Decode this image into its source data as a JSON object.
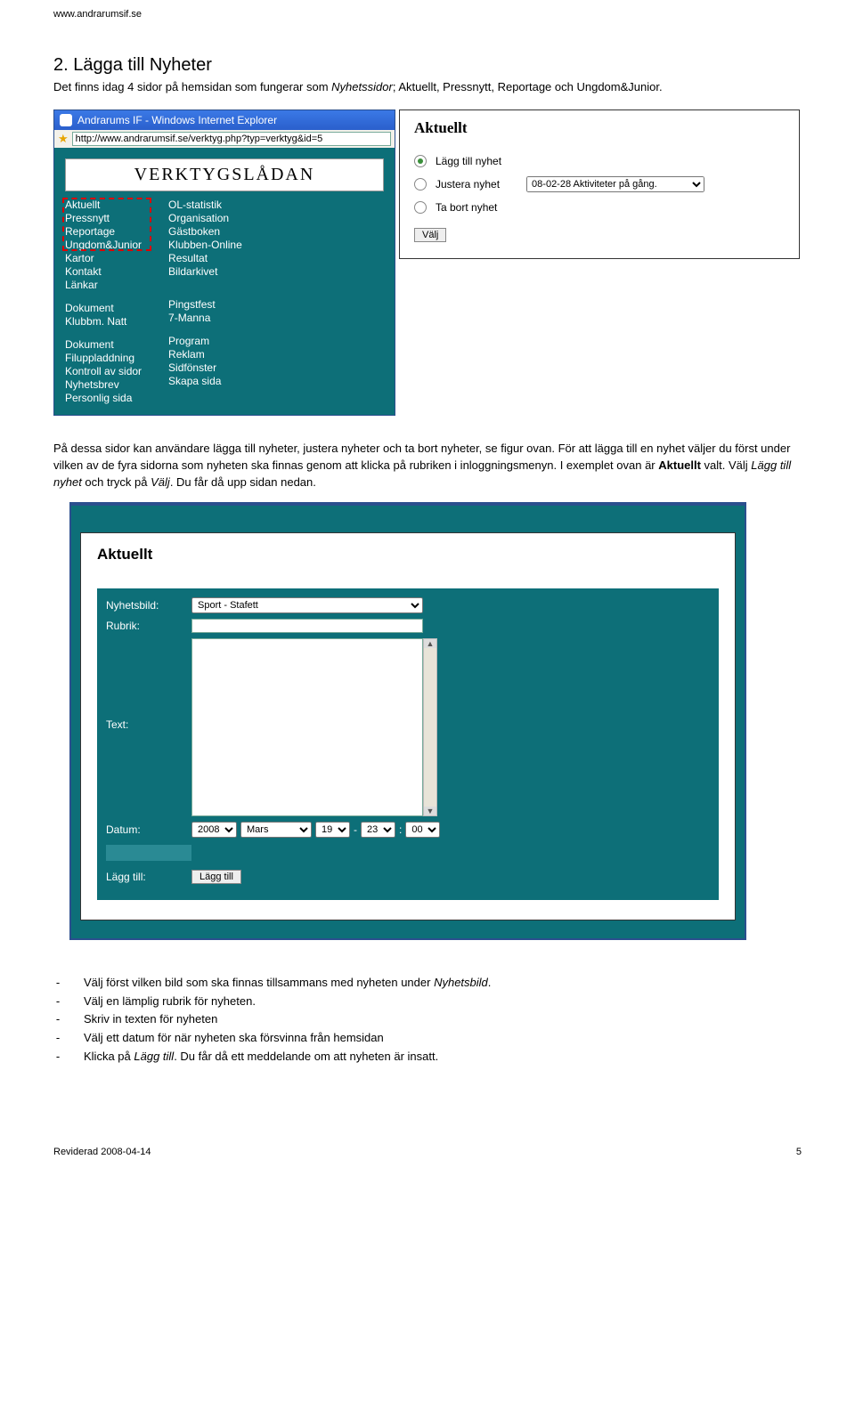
{
  "site_url": "www.andrarumsif.se",
  "heading": "2. Lägga till Nyheter",
  "intro": {
    "part1": "Det finns idag 4 sidor på hemsidan som fungerar som ",
    "italic1": "Nyhetssidor",
    "part2": "; Aktuellt, Pressnytt, Reportage och Ungdom&Junior."
  },
  "ie": {
    "title": "Andrarums IF - Windows Internet Explorer",
    "url": "http://www.andrarumsif.se/verktyg.php?typ=verktyg&id=5"
  },
  "toolsbox_title": "VERKTYGSLÅDAN",
  "tools_col1": [
    "Aktuellt",
    "Pressnytt",
    "Reportage",
    "Ungdom&Junior",
    "Kartor",
    "Kontakt",
    "Länkar",
    "",
    "Dokument",
    "Klubbm. Natt",
    "",
    "Dokument",
    "Filuppladdning",
    "Kontroll av sidor",
    "Nyhetsbrev",
    "Personlig sida"
  ],
  "tools_col2": [
    "OL-statistik",
    "Organisation",
    "Gästboken",
    "Klubben-Online",
    "Resultat",
    "Bildarkivet",
    "",
    "",
    "Pingstfest",
    "7-Manna",
    "",
    "Program",
    "Reklam",
    "Sidfönster",
    "Skapa sida",
    ""
  ],
  "panel": {
    "title": "Aktuellt",
    "opt1": "Lägg till nyhet",
    "opt2": "Justera nyhet",
    "opt3": "Ta bort nyhet",
    "dropdown": "08-02-28 Aktiviteter på gång.",
    "button": "Välj"
  },
  "para2": {
    "t1": "På dessa sidor kan användare lägga till nyheter, justera nyheter och ta bort nyheter, se figur ovan. För att lägga till en nyhet väljer du först under vilken av de fyra sidorna som nyheten ska finnas genom att klicka på rubriken i inloggningsmenyn. I exemplet ovan är ",
    "b1": "Aktuellt",
    "t2": " valt. Välj ",
    "i1": "Lägg till nyhet",
    "t3": " och tryck på ",
    "i2": "Välj",
    "t4": ". Du får då upp sidan nedan."
  },
  "form": {
    "title": "Aktuellt",
    "l_nyhetsbild": "Nyhetsbild:",
    "v_nyhetsbild": "Sport - Stafett",
    "l_rubrik": "Rubrik:",
    "l_text": "Text:",
    "l_datum": "Datum:",
    "year": "2008",
    "month": "Mars",
    "day": "19",
    "hour": "23",
    "min": "00",
    "l_lagg": "Lägg till:",
    "btn_lagg": "Lägg till"
  },
  "bullets": [
    {
      "t1": "Välj först vilken bild som ska finnas tillsammans med nyheten under ",
      "i": "Nyhetsbild",
      "t2": "."
    },
    {
      "t1": "Välj en lämplig rubrik för nyheten."
    },
    {
      "t1": "Skriv in texten för nyheten"
    },
    {
      "t1": "Välj ett datum för när nyheten ska försvinna från hemsidan"
    },
    {
      "t1": "Klicka på ",
      "i": "Lägg till",
      "t2": ". Du får då ett meddelande om att nyheten är insatt."
    }
  ],
  "footer_left": "Reviderad 2008-04-14",
  "footer_right": "5"
}
